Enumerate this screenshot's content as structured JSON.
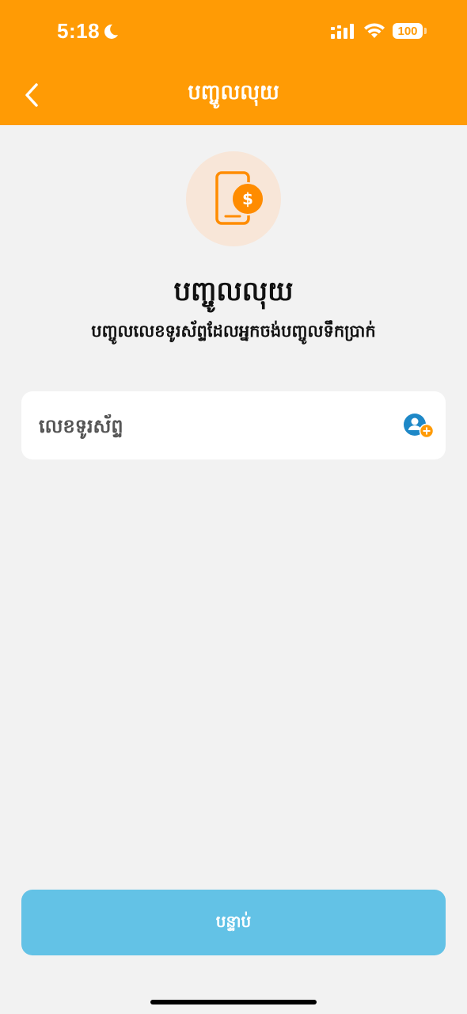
{
  "status_bar": {
    "time": "5:18",
    "battery": "100",
    "icons": [
      "moon-icon",
      "signal-icon",
      "wifi-icon",
      "battery-icon"
    ]
  },
  "header": {
    "title": "បញ្ចូលលុយ",
    "back_icon": "chevron-left-icon"
  },
  "hero": {
    "icon": "phone-dollar-icon",
    "title": "បញ្ចូលលុយ",
    "subtitle": "បញ្ចូលលេខទូរស័ព្ទដែលអ្នកចង់បញ្ចូលទឹកប្រាក់"
  },
  "phone_field": {
    "placeholder": "លេខទូរស័ព្ទ",
    "value": "",
    "contact_icon": "add-contact-icon"
  },
  "next_button": {
    "label": "បន្ទាប់"
  },
  "colors": {
    "header": "#ff9b05",
    "background": "#f2f2f2",
    "button": "#63c2e6",
    "accent": "#ff8c00",
    "contact_blue": "#1e88c7"
  }
}
